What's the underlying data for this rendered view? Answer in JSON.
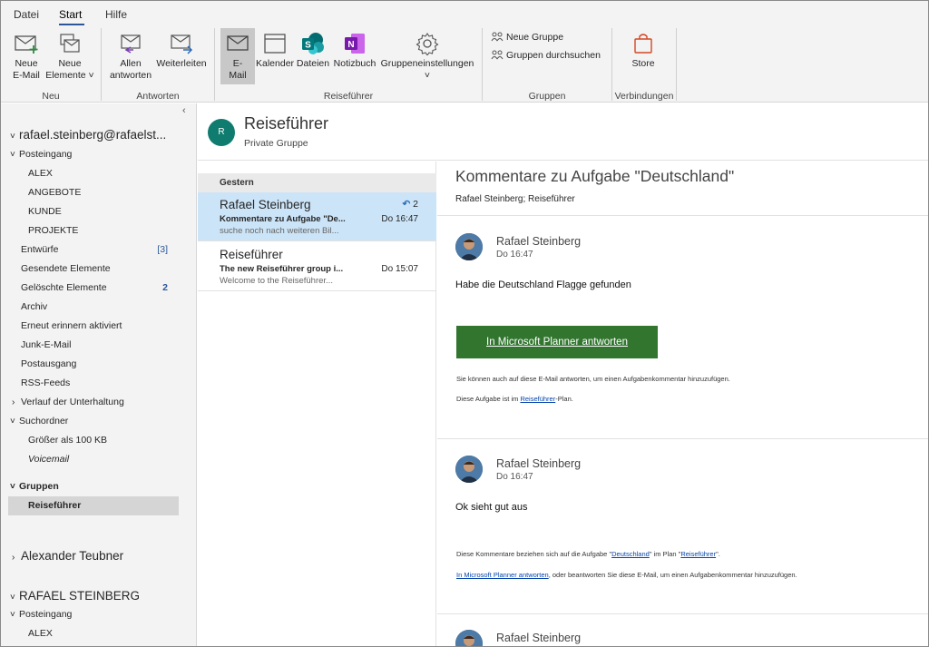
{
  "menu": {
    "file": "Datei",
    "start": "Start",
    "help": "Hilfe"
  },
  "ribbon": {
    "new_email_l1": "Neue",
    "new_email_l2": "E-Mail",
    "new_items_l1": "Neue",
    "new_items_l2": "Elemente",
    "reply_all_l1": "Allen",
    "reply_all_l2": "antworten",
    "forward": "Weiterleiten",
    "email_l1": "E-",
    "email_l2": "Mail",
    "calendar": "Kalender",
    "files": "Dateien",
    "notebook": "Notizbuch",
    "group_settings": "Gruppeneinstellungen",
    "new_group": "Neue Gruppe",
    "browse_groups": "Gruppen durchsuchen",
    "store": "Store",
    "group_new": "Neu",
    "group_replies": "Antworten",
    "group_travel": "Reiseführer",
    "group_groups": "Gruppen",
    "group_connections": "Verbindungen"
  },
  "folders": {
    "account1": "rafael.steinberg@rafaelst...",
    "inbox": "Posteingang",
    "alex": "ALEX",
    "angebote": "ANGEBOTE",
    "kunde": "KUNDE",
    "projekte": "PROJEKTE",
    "drafts": "Entwürfe",
    "drafts_count": "[3]",
    "sent": "Gesendete Elemente",
    "deleted": "Gelöschte Elemente",
    "deleted_count": "2",
    "archive": "Archiv",
    "reminders": "Erneut erinnern aktiviert",
    "junk": "Junk-E-Mail",
    "outbox": "Postausgang",
    "rss": "RSS-Feeds",
    "conversation_history": "Verlauf der Unterhaltung",
    "search_folders": "Suchordner",
    "larger_than": "Größer als 100 KB",
    "voicemail": "Voicemail",
    "groups": "Gruppen",
    "travel_guide": "Reiseführer",
    "account2": "Alexander Teubner",
    "account3": "RAFAEL STEINBERG",
    "inbox2": "Posteingang",
    "alex2": "ALEX"
  },
  "group_header": {
    "initial": "R",
    "title": "Reiseführer",
    "subtitle": "Private Gruppe"
  },
  "message_list": {
    "date_header": "Gestern",
    "items": [
      {
        "from": "Rafael Steinberg",
        "subject": "Kommentare zu Aufgabe \"De...",
        "preview": "suche noch nach weiteren Bil...",
        "time": "Do 16:47",
        "reply_count": "2"
      },
      {
        "from": "Reiseführer",
        "subject": "The new Reiseführer group i...",
        "preview": "Welcome to the Reiseführer...",
        "time": "Do 15:07"
      }
    ]
  },
  "reader": {
    "title": "Kommentare zu Aufgabe \"Deutschland\"",
    "to": "Rafael Steinberg; Reiseführer",
    "msg1": {
      "sender": "Rafael Steinberg",
      "time": "Do 16:47",
      "body": "Habe die Deutschland Flagge gefunden",
      "button": "In Microsoft Planner antworten",
      "note1": "Sie können auch auf diese E-Mail antworten, um einen Aufgabenkommentar hinzuzufügen.",
      "note2_pre": "Diese Aufgabe ist im ",
      "note2_link": "Reiseführer",
      "note2_post": "-Plan."
    },
    "msg2": {
      "sender": "Rafael Steinberg",
      "time": "Do 16:47",
      "body": "Ok sieht gut aus",
      "ref_pre": "Diese Kommentare beziehen sich auf die Aufgabe \"",
      "ref_link1": "Deutschland",
      "ref_mid": "\" im Plan \"",
      "ref_link2": "Reiseführer",
      "ref_post": "\".",
      "reply_link": "In Microsoft Planner antworten",
      "reply_post": ", oder beantworten Sie diese E-Mail, um einen Aufgabenkommentar hinzuzufügen."
    },
    "msg3": {
      "sender": "Rafael Steinberg"
    }
  },
  "colors": {
    "accent": "#2b579a",
    "planner_green": "#31752f",
    "selection": "#cce4f7",
    "group_avatar": "#107c6f"
  }
}
